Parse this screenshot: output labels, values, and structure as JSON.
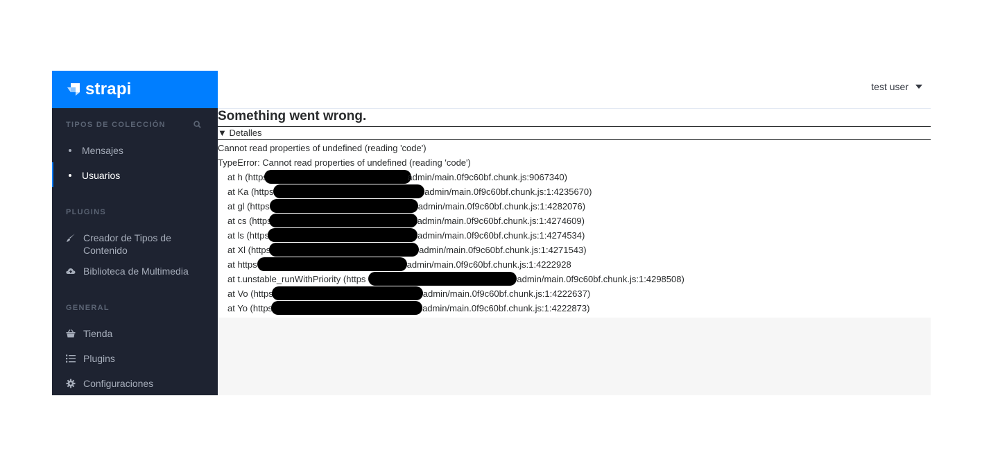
{
  "brand": {
    "name": "strapi"
  },
  "sidebar": {
    "sections": [
      {
        "title": "TIPOS DE COLECCIÓN",
        "items": [
          {
            "label": "Mensajes",
            "active": false
          },
          {
            "label": "Usuarios",
            "active": true
          }
        ]
      },
      {
        "title": "PLUGINS",
        "items": [
          {
            "label": "Creador de Tipos de Contenido",
            "icon": "paintbrush-icon"
          },
          {
            "label": "Biblioteca de Multimedia",
            "icon": "cloud-upload-icon"
          }
        ]
      },
      {
        "title": "GENERAL",
        "items": [
          {
            "label": "Tienda",
            "icon": "shopping-basket-icon"
          },
          {
            "label": "Plugins",
            "icon": "list-icon"
          },
          {
            "label": "Configuraciones",
            "icon": "gear-icon"
          }
        ]
      }
    ]
  },
  "header": {
    "user_label": "test user"
  },
  "error": {
    "title": "Something went wrong.",
    "details_label": "▼ Detalles",
    "message": "Cannot read properties of undefined (reading 'code')",
    "type_error": "TypeError: Cannot read properties of undefined (reading 'code')",
    "stack": [
      {
        "prefix": "at h (https:",
        "suffix": "admin/main.0f9c60bf.chunk.js:9067340)"
      },
      {
        "prefix": "at Ka (https:",
        "suffix": "admin/main.0f9c60bf.chunk.js:1:4235670)"
      },
      {
        "prefix": "at gl (https",
        "suffix": "admin/main.0f9c60bf.chunk.js:1:4282076)"
      },
      {
        "prefix": "at cs (https",
        "suffix": "admin/main.0f9c60bf.chunk.js:1:4274609)"
      },
      {
        "prefix": "at ls (https",
        "suffix": "admin/main.0f9c60bf.chunk.js:1:4274534)"
      },
      {
        "prefix": "at Xl (https",
        "suffix": "admin/main.0f9c60bf.chunk.js:1:4271543)"
      },
      {
        "prefix": "at https",
        "suffix": "admin/main.0f9c60bf.chunk.js:1:4222928"
      },
      {
        "prefix": "at t.unstable_runWithPriority (https",
        "suffix": "admin/main.0f9c60bf.chunk.js:1:4298508)"
      },
      {
        "prefix": "at Vo (https",
        "suffix": "admin/main.0f9c60bf.chunk.js:1:4222637)"
      },
      {
        "prefix": "at Yo (https",
        "suffix": "admin/main.0f9c60bf.chunk.js:1:4222873)"
      }
    ]
  },
  "colors": {
    "brand": "#007eff",
    "sidebar_bg": "#1e2331",
    "sidebar_text": "#a6adba",
    "section_title": "#5b6474"
  }
}
